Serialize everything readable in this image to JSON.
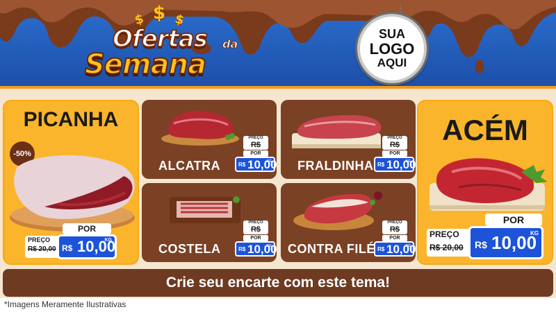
{
  "header": {
    "title_line1": "Ofertas",
    "title_line1_small": "da",
    "title_line2": "Semana",
    "dollar_signs": [
      "$",
      "$",
      "$"
    ],
    "logo": [
      "SUA",
      "LOGO",
      "AQUI"
    ]
  },
  "featured_left": {
    "name": "PICANHA",
    "discount": "-50%",
    "preco_label": "PREÇO",
    "old_price": "R$ 20,00",
    "por_label": "POR",
    "currency": "R$",
    "new_price": "10,00",
    "unit": "KG"
  },
  "featured_right": {
    "name": "ACÉM",
    "preco_label": "PREÇO",
    "old_price": "R$ 20,00",
    "por_label": "POR",
    "currency": "R$",
    "new_price": "10,00",
    "unit": "KG"
  },
  "products": [
    {
      "name": "ALCATRA",
      "preco_label": "PREÇO",
      "old_price": "R$ 20,00",
      "por_label": "POR",
      "currency": "R$",
      "new_price": "10,00",
      "unit": "KG"
    },
    {
      "name": "FRALDINHA",
      "preco_label": "PREÇO",
      "old_price": "R$ 20,00",
      "por_label": "POR",
      "currency": "R$",
      "new_price": "10,00",
      "unit": "KG"
    },
    {
      "name": "COSTELA",
      "preco_label": "PREÇO",
      "old_price": "R$ 20,00",
      "por_label": "POR",
      "currency": "R$",
      "new_price": "10,00",
      "unit": "KG"
    },
    {
      "name": "CONTRA FILÉ",
      "preco_label": "PREÇO",
      "old_price": "R$ 20,00",
      "por_label": "POR",
      "currency": "R$",
      "new_price": "10,00",
      "unit": "KG"
    }
  ],
  "banner": "Crie seu encarte com este tema!",
  "footer": "*Imagens Meramente Ilustrativas",
  "colors": {
    "header_blue": "#1c4fa8",
    "chocolate": "#6e3a22",
    "card_yellow": "#fbb52c",
    "price_blue": "#1c53d9",
    "accent_orange": "#f39a1c"
  }
}
